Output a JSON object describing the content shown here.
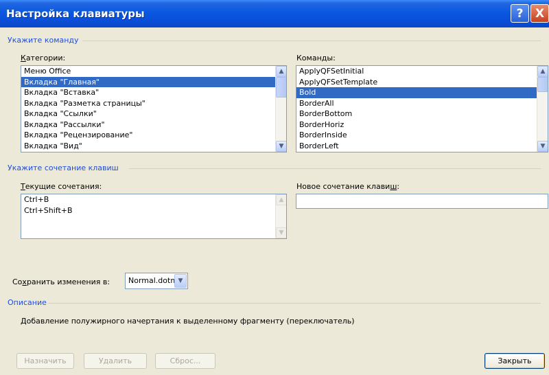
{
  "window": {
    "title": "Настройка клавиатуры",
    "help_glyph": "?",
    "close_glyph": "X"
  },
  "command_group": {
    "label": "Укажите команду",
    "categories": {
      "label_underline": "К",
      "label_rest": "атегории:",
      "items": [
        {
          "label": "Меню Office"
        },
        {
          "label": "Вкладка \"Главная\""
        },
        {
          "label": "Вкладка \"Вставка\""
        },
        {
          "label": "Вкладка \"Разметка страницы\""
        },
        {
          "label": "Вкладка \"Ссылки\""
        },
        {
          "label": "Вкладка \"Рассылки\""
        },
        {
          "label": "Вкладка \"Рецензирование\""
        },
        {
          "label": "Вкладка \"Вид\""
        }
      ],
      "selected_index": 1
    },
    "commands": {
      "label_pre": "Коман",
      "label_underline": "д",
      "label_post": "ы:",
      "items": [
        {
          "label": "ApplyQFSetInitial"
        },
        {
          "label": "ApplyQFSetTemplate"
        },
        {
          "label": "Bold"
        },
        {
          "label": "BorderAll"
        },
        {
          "label": "BorderBottom"
        },
        {
          "label": "BorderHoriz"
        },
        {
          "label": "BorderInside"
        },
        {
          "label": "BorderLeft"
        }
      ],
      "selected_index": 2
    }
  },
  "keys_group": {
    "label": "Укажите сочетание клавиш",
    "current": {
      "label_underline": "Т",
      "label_rest": "екущие сочетания:",
      "items": [
        {
          "label": "Ctrl+B"
        },
        {
          "label": "Ctrl+Shift+B"
        }
      ]
    },
    "new_key": {
      "label_pre": "Новое сочетание клави",
      "label_underline": "ш",
      "label_post": ":",
      "value": ""
    }
  },
  "save_in": {
    "label_pre": "Со",
    "label_underline": "х",
    "label_post": "ранить изменения в:",
    "value": "Normal.dotm"
  },
  "description": {
    "label": "Описание",
    "text": "Добавление полужирного начертания к выделенному фрагменту (переключатель)"
  },
  "buttons": {
    "assign": "Назначить",
    "remove": "Удалить",
    "reset": "Сброс...",
    "close": "Закрыть"
  },
  "icons": {
    "scroll_up": "▲",
    "scroll_down": "▼",
    "dropdown": "▼"
  },
  "colors": {
    "titlebar": "#0a58e0",
    "selection": "#316ac5",
    "group_label": "#1e4ed8",
    "dialog_bg": "#ece9d8"
  }
}
